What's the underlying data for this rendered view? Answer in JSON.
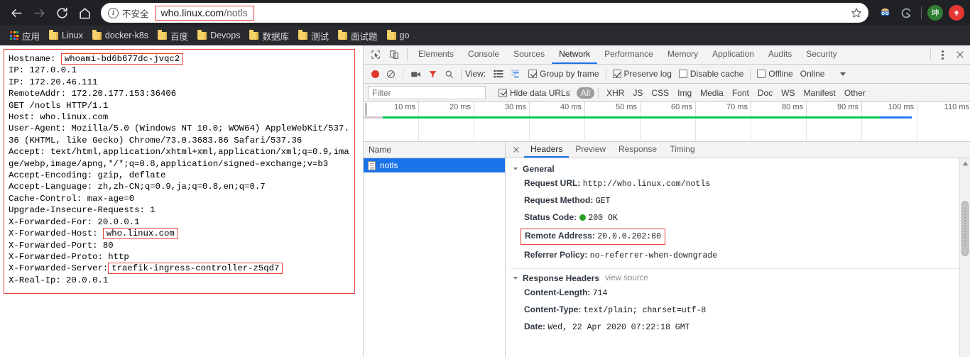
{
  "browser": {
    "nav": {
      "back": "back-arrow",
      "forward": "forward-arrow",
      "reload": "reload",
      "home": "home"
    },
    "security_label": "不安全",
    "url_prefix": "who.linux.com",
    "url_path": "/notls",
    "url_full": "who.linux.com/notls",
    "profile_badge": "坤"
  },
  "bookmarks": [
    {
      "label": "应用",
      "icon": "apps-grid-icon"
    },
    {
      "label": "Linux",
      "icon": "folder-icon"
    },
    {
      "label": "docker-k8s",
      "icon": "folder-icon"
    },
    {
      "label": "百度",
      "icon": "folder-icon"
    },
    {
      "label": "Devops",
      "icon": "folder-icon"
    },
    {
      "label": "数据库",
      "icon": "folder-icon"
    },
    {
      "label": "测试",
      "icon": "folder-icon"
    },
    {
      "label": "面试题",
      "icon": "folder-icon"
    },
    {
      "label": "go",
      "icon": "folder-icon"
    }
  ],
  "page": {
    "hostname_label": "Hostname:",
    "hostname_value": "whoami-bd6b677dc-jvqc2",
    "lines_before_xf": [
      "IP: 127.0.0.1",
      "IP: 172.20.46.111",
      "RemoteAddr: 172.20.177.153:36406",
      "GET /notls HTTP/1.1",
      "Host: who.linux.com",
      "User-Agent: Mozilla/5.0 (Windows NT 10.0; WOW64) AppleWebKit/537.36 (KHTML, like Gecko) Chrome/73.0.3683.86 Safari/537.36",
      "Accept: text/html,application/xhtml+xml,application/xml;q=0.9,image/webp,image/apng,*/*;q=0.8,application/signed-exchange;v=b3",
      "Accept-Encoding: gzip, deflate",
      "Accept-Language: zh,zh-CN;q=0.9,ja;q=0.8,en;q=0.7",
      "Cache-Control: max-age=0",
      "Upgrade-Insecure-Requests: 1",
      "X-Forwarded-For: 20.0.0.1"
    ],
    "xf_host_label": "X-Forwarded-Host:",
    "xf_host_value": "who.linux.com",
    "lines_mid": [
      "X-Forwarded-Port: 80",
      "X-Forwarded-Proto: http"
    ],
    "xf_server_label": "X-Forwarded-Server:",
    "xf_server_value": "traefik-ingress-controller-z5qd7",
    "lines_after": [
      "X-Real-Ip: 20.0.0.1"
    ]
  },
  "devtools": {
    "tabs": [
      {
        "label": "Elements",
        "active": false
      },
      {
        "label": "Console",
        "active": false
      },
      {
        "label": "Sources",
        "active": false
      },
      {
        "label": "Network",
        "active": true
      },
      {
        "label": "Performance",
        "active": false
      },
      {
        "label": "Memory",
        "active": false
      },
      {
        "label": "Application",
        "active": false
      },
      {
        "label": "Audits",
        "active": false
      },
      {
        "label": "Security",
        "active": false
      }
    ],
    "toolbar": {
      "record_icon": "record-circle-icon",
      "clear_icon": "clear-icon",
      "camera_icon": "screenshot-camera-icon",
      "filter_icon": "filter-funnel-icon",
      "search_icon": "search-icon",
      "view_label": "View:",
      "list_view_icon": "list-view-icon",
      "waterfall_view_icon": "waterfall-view-icon",
      "group_by_frame": "Group by frame",
      "group_by_frame_checked": true,
      "preserve_log": "Preserve log",
      "preserve_log_checked": true,
      "disable_cache": "Disable cache",
      "disable_cache_checked": false,
      "offline": "Offline",
      "offline_checked": false,
      "online": "Online"
    },
    "filterbar": {
      "filter_placeholder": "Filter",
      "filter_value": "",
      "hide_data_urls": "Hide data URLs",
      "hide_data_urls_checked": true,
      "types": [
        "All",
        "XHR",
        "JS",
        "CSS",
        "Img",
        "Media",
        "Font",
        "Doc",
        "WS",
        "Manifest",
        "Other"
      ],
      "active_type": "All"
    },
    "overview": {
      "ticks": [
        "10 ms",
        "20 ms",
        "30 ms",
        "40 ms",
        "50 ms",
        "60 ms",
        "70 ms",
        "80 ms",
        "90 ms",
        "100 ms",
        "110 ms"
      ],
      "bar_green_color": "#00c853",
      "bar_blue_color": "#2979ff"
    },
    "requests": {
      "column_header": "Name",
      "rows": [
        {
          "name": "notls",
          "icon": "document-icon",
          "selected": true
        }
      ]
    },
    "detail": {
      "close_icon": "close-icon",
      "tabs": [
        {
          "label": "Headers",
          "active": true
        },
        {
          "label": "Preview",
          "active": false
        },
        {
          "label": "Response",
          "active": false
        },
        {
          "label": "Timing",
          "active": false
        }
      ],
      "general": {
        "title": "General",
        "items": [
          {
            "key": "Request URL:",
            "value": "http://who.linux.com/notls",
            "highlight": false,
            "status": false
          },
          {
            "key": "Request Method:",
            "value": "GET",
            "highlight": false,
            "status": false
          },
          {
            "key": "Status Code:",
            "value": "200 OK",
            "highlight": false,
            "status": true
          },
          {
            "key": "Remote Address:",
            "value": "20.0.0.202:80",
            "highlight": true,
            "status": false
          },
          {
            "key": "Referrer Policy:",
            "value": "no-referrer-when-downgrade",
            "highlight": false,
            "status": false
          }
        ]
      },
      "response_headers": {
        "title": "Response Headers",
        "view_source": "view source",
        "items": [
          {
            "key": "Content-Length:",
            "value": "714"
          },
          {
            "key": "Content-Type:",
            "value": "text/plain; charset=utf-8"
          },
          {
            "key": "Date:",
            "value": "Wed, 22 Apr 2020 07:22:18 GMT"
          }
        ]
      }
    }
  },
  "colors": {
    "chrome_bg": "#202124",
    "bookmark_bg": "#292a2d",
    "accent_blue": "#1a73e8",
    "highlight_red": "#e8453c",
    "status_green": "#25a11e"
  }
}
